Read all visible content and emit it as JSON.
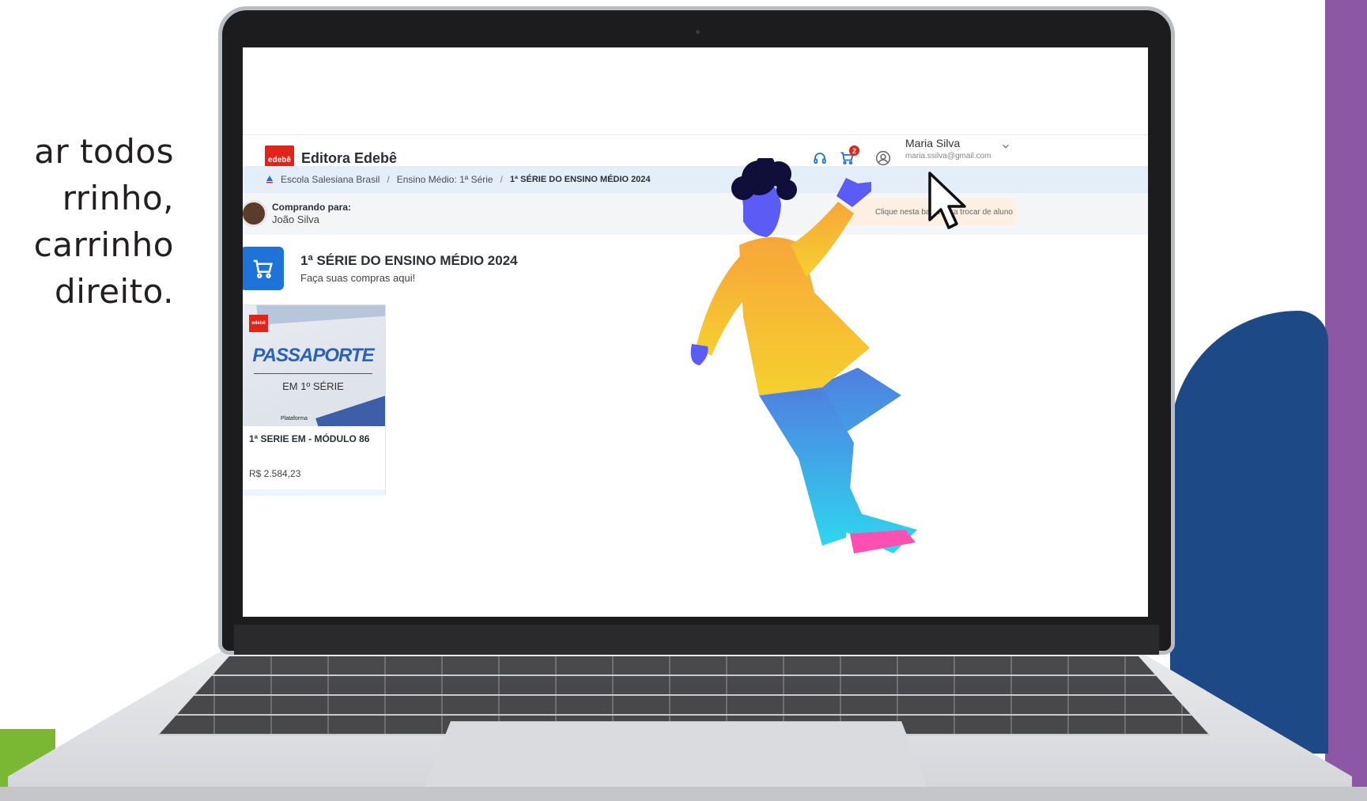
{
  "side_text": {
    "lines": [
      "ar todos",
      "rrinho,",
      " carrinho",
      "direito."
    ]
  },
  "header": {
    "logo_text": "edebê",
    "brand_name": "Editora Edebê",
    "cart_count": "2",
    "user_name": "Maria Silva",
    "user_email": "maria.ssilva@gmail.com"
  },
  "breadcrumb": {
    "items": [
      "Escola Salesiana Brasil",
      "Ensino Médio: 1ª Série",
      "1ª SÉRIE DO ENSINO MÉDIO 2024"
    ],
    "separator": "/"
  },
  "buying_for": {
    "label": "Comprando para:",
    "name": "João Silva",
    "hint": "Clique nesta barra para trocar de aluno"
  },
  "catalog": {
    "title": "1ª SÉRIE DO ENSINO MÉDIO 2024",
    "subtitle": "Faça suas compras aqui!"
  },
  "products": [
    {
      "image_badge": "edebê",
      "image_title": "PASSAPORTE",
      "image_subtitle": "EM 1º SÉRIE",
      "image_footer": "Plataforma",
      "title": "1ª SERIE EM - MÓDULO 86",
      "price": "R$ 2.584,23"
    }
  ],
  "colors": {
    "accent": "#1e73d8",
    "brand_red": "#e2231a",
    "breadcrumb_bg": "#e3eef9",
    "hint_bg": "#fdf0e3",
    "purple_band": "#8c58a6",
    "blue_shape": "#1d4a86",
    "green_shape": "#7ab833"
  },
  "icons": {
    "support": "headset-icon",
    "cart": "cart-icon",
    "user": "user-circle-icon",
    "chevron": "chevron-down-icon",
    "catalog": "cart-icon"
  }
}
